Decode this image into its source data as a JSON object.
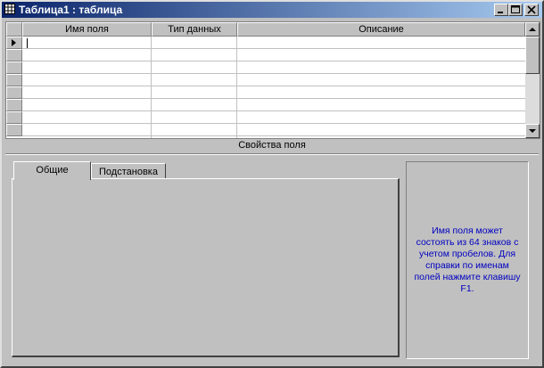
{
  "window": {
    "title": "Таблица1 : таблица",
    "controls": [
      "minimize-icon",
      "maximize-icon",
      "close-icon"
    ]
  },
  "grid": {
    "columns": [
      "Имя поля",
      "Тип данных",
      "Описание"
    ],
    "current_row_indicator": "arrow-right-icon",
    "rows": [
      [
        "",
        "",
        ""
      ],
      [
        "",
        "",
        ""
      ],
      [
        "",
        "",
        ""
      ],
      [
        "",
        "",
        ""
      ],
      [
        "",
        "",
        ""
      ],
      [
        "",
        "",
        ""
      ],
      [
        "",
        "",
        ""
      ],
      [
        "",
        "",
        ""
      ],
      [
        "",
        "",
        ""
      ],
      [
        "",
        "",
        ""
      ]
    ]
  },
  "properties": {
    "label": "Свойства поля",
    "tabs": [
      {
        "label": "Общие",
        "active": true
      },
      {
        "label": "Подстановка",
        "active": false
      }
    ],
    "help_text": "Имя поля может состоять из 64 знаков с учетом пробелов.  Для справки по именам полей нажмите клавишу F1."
  },
  "colors": {
    "title_gradient_start": "#0a246a",
    "title_gradient_end": "#a6caf0",
    "help_text": "#0000c0",
    "surface": "#c0c0c0"
  }
}
